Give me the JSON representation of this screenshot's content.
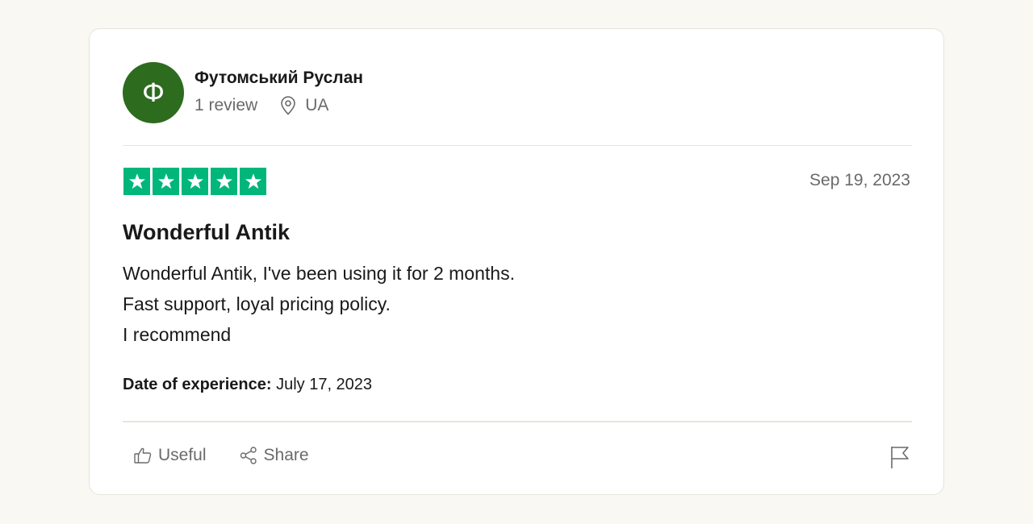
{
  "consumer": {
    "avatar_initial": "Ф",
    "avatar_color": "#2d6b1f",
    "name": "Футомський Руслан",
    "reviews_count": "1 review",
    "location_icon": "location-pin-icon",
    "country": "UA"
  },
  "review": {
    "rating": 5,
    "rating_max": 5,
    "star_color": "#00b67a",
    "date": "Sep 19, 2023",
    "title": "Wonderful Antik",
    "body_lines": [
      "Wonderful Antik, I've been using it for 2 months.",
      "Fast support, loyal pricing policy.",
      "I recommend"
    ],
    "experience_label": "Date of experience:",
    "experience_date": "July 17, 2023"
  },
  "actions": {
    "useful_icon": "thumbs-up-icon",
    "useful_label": "Useful",
    "share_icon": "share-icon",
    "share_label": "Share",
    "report_icon": "flag-icon"
  }
}
